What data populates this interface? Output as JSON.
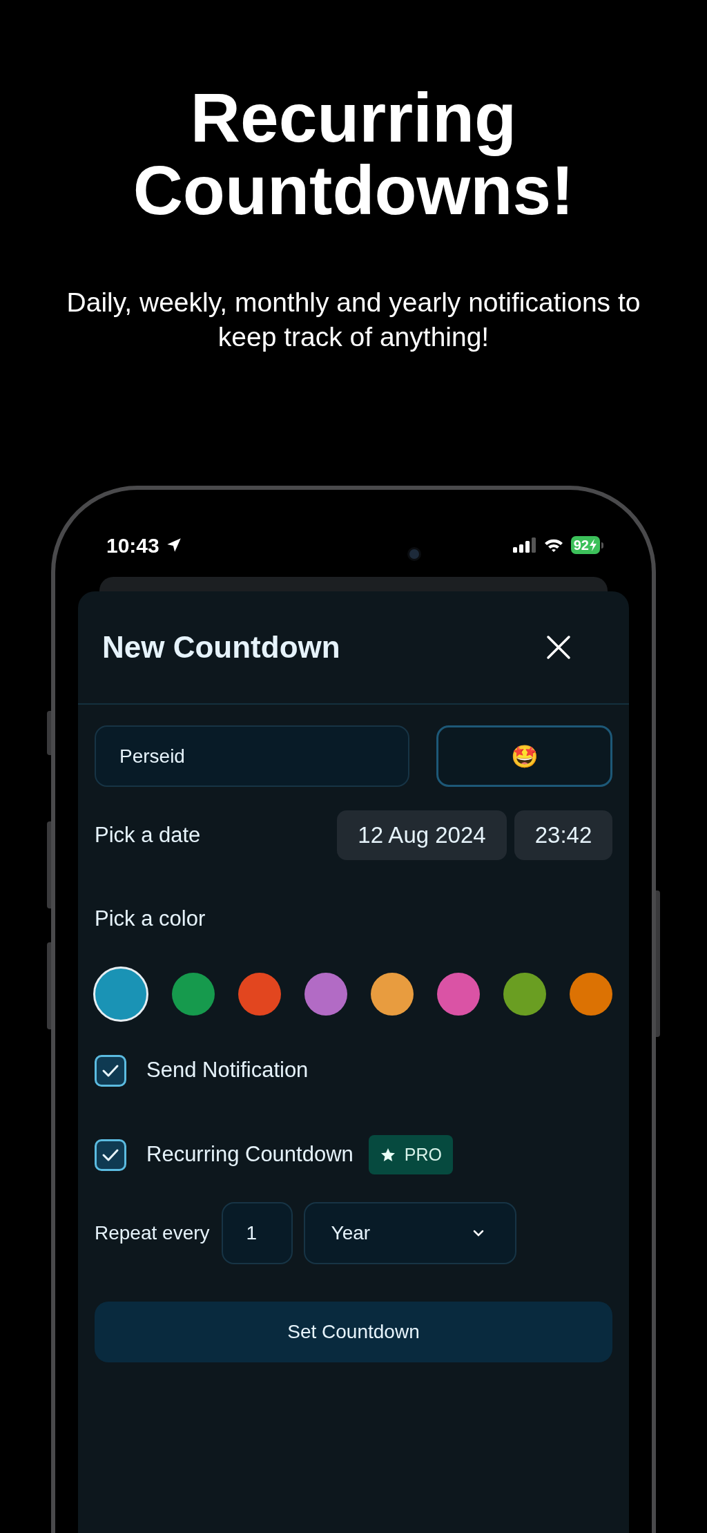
{
  "headline": {
    "title": "Recurring Countdowns!",
    "subtitle": "Daily, weekly, monthly and yearly notifications to keep track of anything!"
  },
  "status_bar": {
    "time": "10:43",
    "battery": "92"
  },
  "sheet": {
    "title": "New Countdown",
    "name_field": {
      "value": "Perseid"
    },
    "emoji": "🤩",
    "date_label": "Pick a date",
    "date": "12 Aug 2024",
    "time": "23:42",
    "color_label": "Pick a color",
    "colors": [
      {
        "color": "#1a93b5",
        "selected": true
      },
      {
        "color": "#169a4d",
        "selected": false
      },
      {
        "color": "#e2461f",
        "selected": false
      },
      {
        "color": "#b26bc5",
        "selected": false
      },
      {
        "color": "#e89c3f",
        "selected": false
      },
      {
        "color": "#da53a5",
        "selected": false
      },
      {
        "color": "#6a9e22",
        "selected": false
      },
      {
        "color": "#dc7203",
        "selected": false
      }
    ],
    "options": [
      {
        "label": "Send Notification",
        "checked": true
      },
      {
        "label": "Recurring Countdown",
        "checked": true,
        "badge": "PRO"
      }
    ],
    "repeat": {
      "label": "Repeat every",
      "count": "1",
      "unit": "Year"
    },
    "submit": "Set Countdown"
  }
}
